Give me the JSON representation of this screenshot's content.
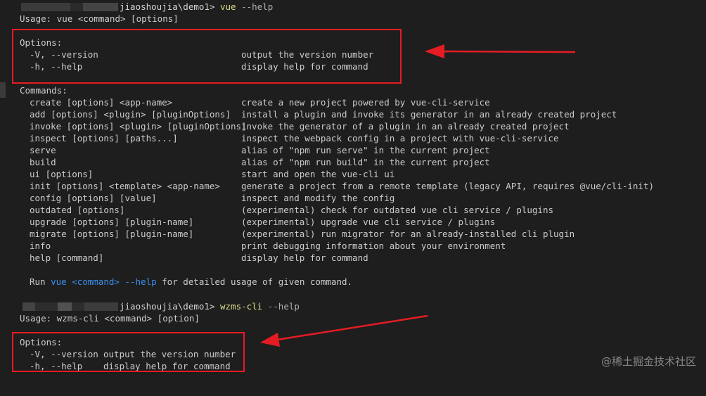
{
  "prompt1": {
    "path": "jiaoshoujia\\demo1>",
    "cmd": "vue",
    "args": " --help"
  },
  "usage1": "Usage: vue <command> [options]",
  "options_header": "Options:",
  "options1": [
    {
      "flag": "-V, --version",
      "desc": "output the version number"
    },
    {
      "flag": "-h, --help",
      "desc": "display help for command"
    }
  ],
  "commands_header": "Commands:",
  "commands": [
    {
      "cmd": "create [options] <app-name>",
      "desc": "create a new project powered by vue-cli-service"
    },
    {
      "cmd": "add [options] <plugin> [pluginOptions]",
      "desc": "install a plugin and invoke its generator in an already created project"
    },
    {
      "cmd": "invoke [options] <plugin> [pluginOptions]",
      "desc": "invoke the generator of a plugin in an already created project"
    },
    {
      "cmd": "inspect [options] [paths...]",
      "desc": "inspect the webpack config in a project with vue-cli-service"
    },
    {
      "cmd": "serve",
      "desc": "alias of \"npm run serve\" in the current project"
    },
    {
      "cmd": "build",
      "desc": "alias of \"npm run build\" in the current project"
    },
    {
      "cmd": "ui [options]",
      "desc": "start and open the vue-cli ui"
    },
    {
      "cmd": "init [options] <template> <app-name>",
      "desc": "generate a project from a remote template (legacy API, requires @vue/cli-init)"
    },
    {
      "cmd": "config [options] [value]",
      "desc": "inspect and modify the config"
    },
    {
      "cmd": "outdated [options]",
      "desc": "(experimental) check for outdated vue cli service / plugins"
    },
    {
      "cmd": "upgrade [options] [plugin-name]",
      "desc": "(experimental) upgrade vue cli service / plugins"
    },
    {
      "cmd": "migrate [options] [plugin-name]",
      "desc": "(experimental) run migrator for an already-installed cli plugin"
    },
    {
      "cmd": "info",
      "desc": "print debugging information about your environment"
    },
    {
      "cmd": "help [command]",
      "desc": "display help for command"
    }
  ],
  "run_line": {
    "pre": "Run ",
    "cmd": "vue <command> --help",
    "post": " for detailed usage of given command."
  },
  "prompt2": {
    "path": "jiaoshoujia\\demo1>",
    "cmd": "wzms-cli",
    "args": " --help"
  },
  "usage2": "Usage: wzms-cli <command> [option]",
  "options2": [
    {
      "flag": "-V, --version",
      "desc": "output the version number"
    },
    {
      "flag": "-h, --help",
      "desc": "display help for command"
    }
  ],
  "watermark": "@稀土掘金技术社区",
  "colors": {
    "background": "#1e1e1e",
    "text": "#cccccc",
    "command": "#dcdc8b",
    "highlight": "#3b8eea",
    "annotation": "#e51c23"
  }
}
